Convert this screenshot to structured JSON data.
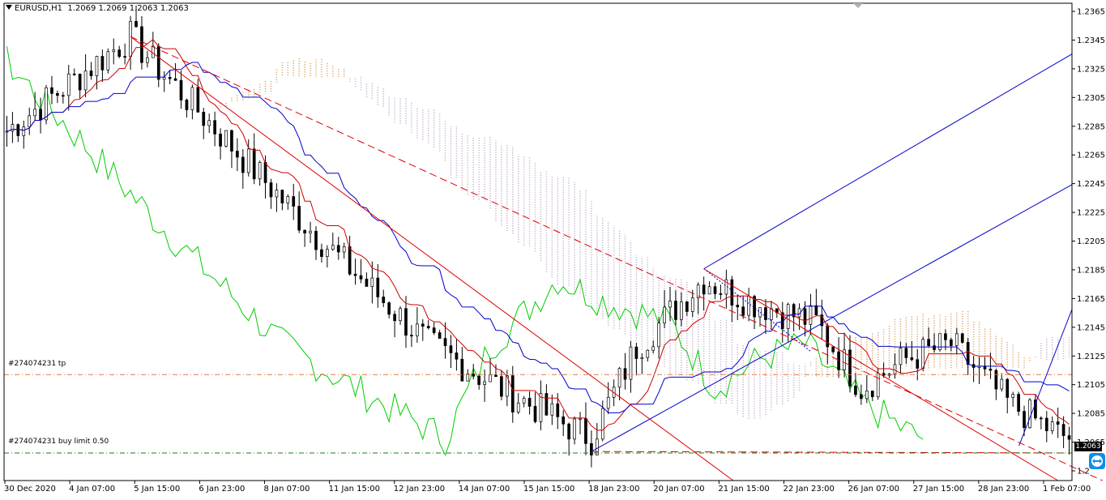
{
  "header": {
    "symbol": "EURUSD,H1",
    "ohlc": "1.2069 1.2069 1.2063 1.2063"
  },
  "current_price_label": "1.2063",
  "order_lines": {
    "tp_label": "#274074231 tp",
    "buy_label": "#274074231 buy limit 0.50"
  },
  "colors": {
    "background": "#ffffff",
    "candles": "#000000",
    "chikou": "#00cc00",
    "tenkan": "#cc0000",
    "kijun": "#0000cc",
    "cloud_bull": "#d79a5a",
    "cloud_bear": "#c0a8c8",
    "pitchfork": "#0000cc",
    "fan": "#dd0000",
    "tp_line": "#e0783c",
    "buy_line": "#1a7a1a"
  },
  "icons": {
    "dropdown": "triangle-down-icon",
    "chart_shift": "gray-triangle-icon",
    "corner": "teamviewer-icon"
  },
  "chart_data": {
    "type": "candlestick",
    "title": "EURUSD,H1",
    "ylim": [
      1.2046,
      1.2375
    ],
    "y_ticks": [
      "1.2365",
      "1.2345",
      "1.2325",
      "1.2305",
      "1.2285",
      "1.2265",
      "1.2245",
      "1.2225",
      "1.2205",
      "1.2185",
      "1.2165",
      "1.2145",
      "1.2125",
      "1.2105",
      "1.2085",
      "1.2065",
      "1.2"
    ],
    "x_ticks": [
      "30 Dec 2020",
      "4 Jan 07:00",
      "5 Jan 15:00",
      "6 Jan 23:00",
      "8 Jan 07:00",
      "11 Jan 15:00",
      "12 Jan 23:00",
      "14 Jan 07:00",
      "15 Jan 15:00",
      "18 Jan 23:00",
      "20 Jan 07:00",
      "21 Jan 15:00",
      "22 Jan 23:00",
      "26 Jan 07:00",
      "27 Jan 15:00",
      "28 Jan 23:00",
      "1 Feb 07:00"
    ],
    "current_price": 1.2063,
    "tp_level": 1.2119,
    "buy_limit_level": 1.2065,
    "anchor_points": [
      {
        "bar": 0,
        "price": 1.2287
      },
      {
        "bar": 22,
        "price": 1.2352
      },
      {
        "bar": 27,
        "price": 1.233
      },
      {
        "bar": 55,
        "price": 1.2215
      },
      {
        "bar": 75,
        "price": 1.214
      },
      {
        "bar": 90,
        "price": 1.2105
      },
      {
        "bar": 104,
        "price": 1.2075
      },
      {
        "bar": 112,
        "price": 1.2138
      },
      {
        "bar": 124,
        "price": 1.2185
      },
      {
        "bar": 132,
        "price": 1.217
      },
      {
        "bar": 144,
        "price": 1.2155
      },
      {
        "bar": 152,
        "price": 1.211
      },
      {
        "bar": 160,
        "price": 1.213
      },
      {
        "bar": 168,
        "price": 1.214
      },
      {
        "bar": 178,
        "price": 1.21
      },
      {
        "bar": 187,
        "price": 1.2078
      }
    ],
    "pitchfork": {
      "p1": {
        "x": 1.7,
        "price": 1.219
      },
      "p2": {
        "x": 1.0,
        "price": 1.2055
      },
      "p3": {
        "x": 2.0,
        "price": 1.2063
      },
      "median_end": {
        "x": 3.0,
        "price": 1.225
      },
      "upper_end": {
        "x": 3.0,
        "price": 1.234
      },
      "lower_end": {
        "x": 3.0,
        "price": 1.2164
      }
    }
  }
}
